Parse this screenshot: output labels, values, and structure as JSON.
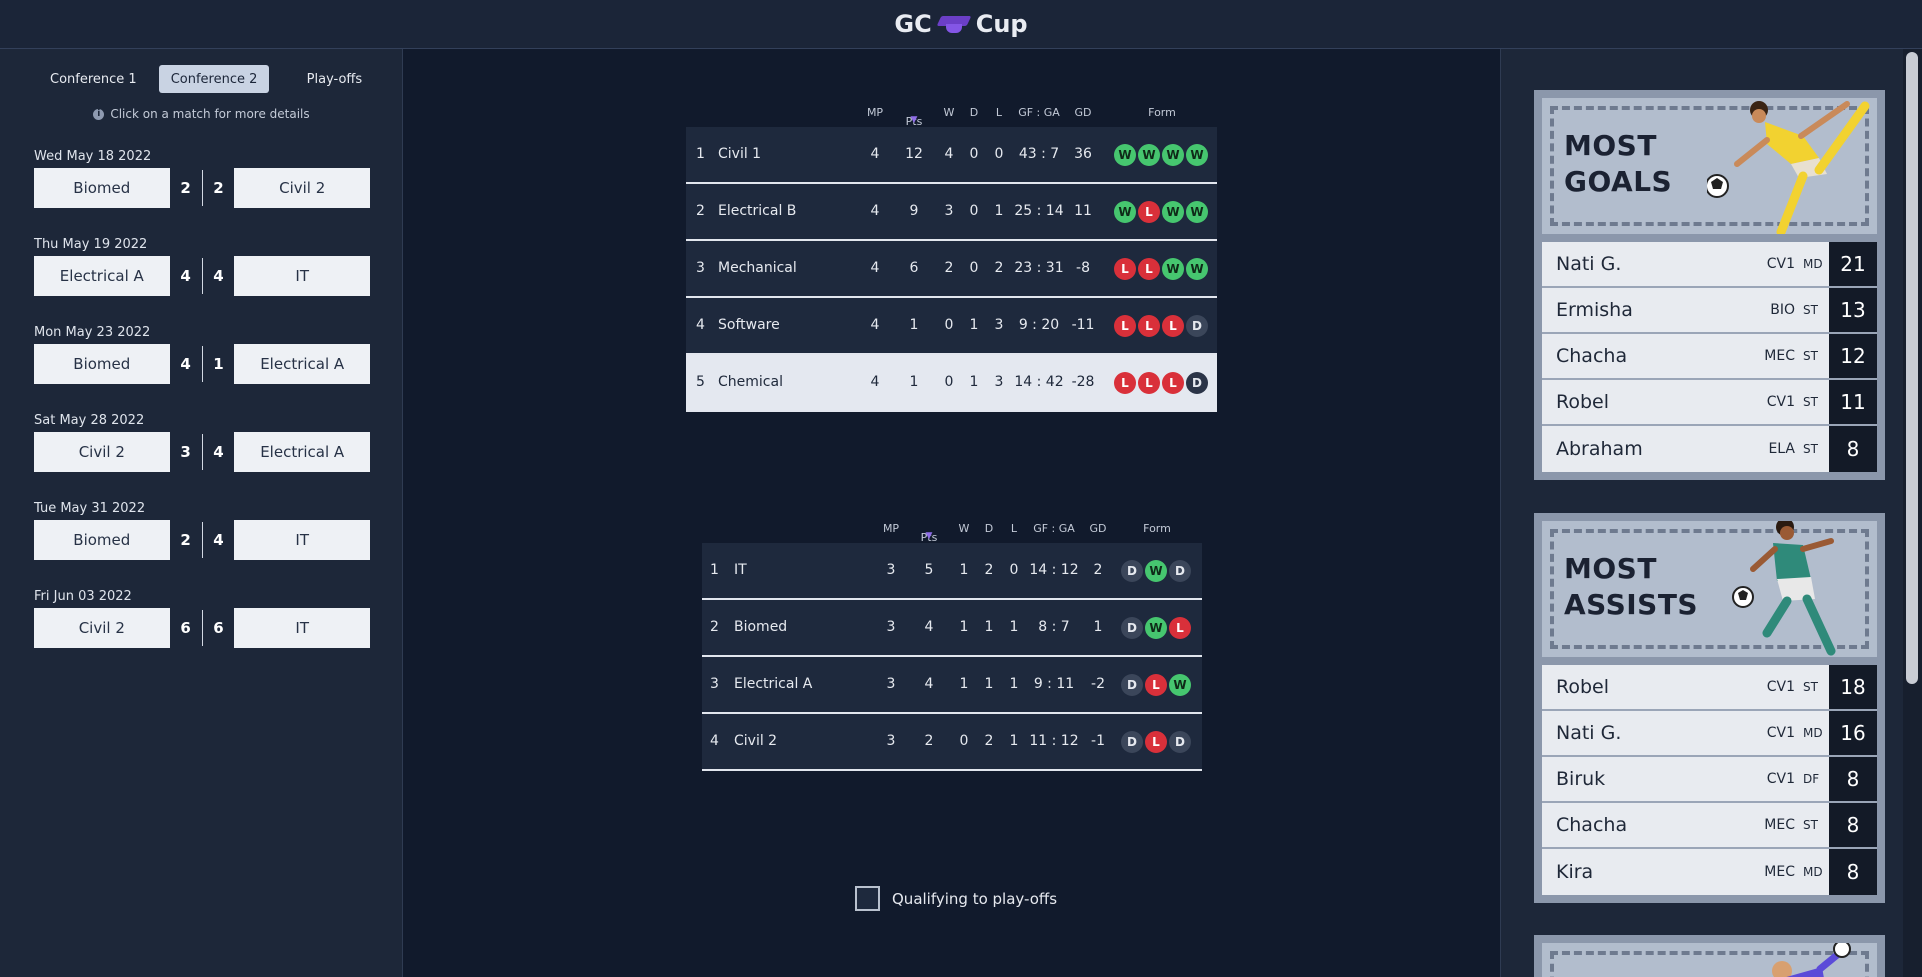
{
  "header": {
    "title_left": "GC",
    "title_right": "Cup"
  },
  "sidebar": {
    "tabs": [
      "Conference 1",
      "Conference 2",
      "Play-offs"
    ],
    "hint": "Click on a match for more details",
    "matches": [
      {
        "date": "Wed May 18 2022",
        "home": "Biomed",
        "home_score": "2",
        "away_score": "2",
        "away": "Civil 2"
      },
      {
        "date": "Thu May 19 2022",
        "home": "Electrical A",
        "home_score": "4",
        "away_score": "4",
        "away": "IT"
      },
      {
        "date": "Mon May 23 2022",
        "home": "Biomed",
        "home_score": "4",
        "away_score": "1",
        "away": "Electrical A"
      },
      {
        "date": "Sat May 28 2022",
        "home": "Civil 2",
        "home_score": "3",
        "away_score": "4",
        "away": "Electrical A"
      },
      {
        "date": "Tue May 31 2022",
        "home": "Biomed",
        "home_score": "2",
        "away_score": "4",
        "away": "IT"
      },
      {
        "date": "Fri Jun 03 2022",
        "home": "Civil 2",
        "home_score": "6",
        "away_score": "6",
        "away": "IT"
      }
    ]
  },
  "standings": {
    "columns": {
      "mp": "MP",
      "pts": "Pts",
      "w": "W",
      "d": "D",
      "l": "L",
      "gfga": "GF : GA",
      "gd": "GD",
      "form": "Form"
    },
    "tables": [
      {
        "rows": [
          {
            "rank": "1",
            "team": "Civil 1",
            "mp": "4",
            "pts": "12",
            "w": "4",
            "d": "0",
            "l": "0",
            "gfga": "43 : 7",
            "gd": "36",
            "form": [
              "W",
              "W",
              "W",
              "W"
            ]
          },
          {
            "rank": "2",
            "team": "Electrical B",
            "mp": "4",
            "pts": "9",
            "w": "3",
            "d": "0",
            "l": "1",
            "gfga": "25 : 14",
            "gd": "11",
            "form": [
              "W",
              "L",
              "W",
              "W"
            ]
          },
          {
            "rank": "3",
            "team": "Mechanical",
            "mp": "4",
            "pts": "6",
            "w": "2",
            "d": "0",
            "l": "2",
            "gfga": "23 : 31",
            "gd": "-8",
            "form": [
              "L",
              "L",
              "W",
              "W"
            ]
          },
          {
            "rank": "4",
            "team": "Software",
            "mp": "4",
            "pts": "1",
            "w": "0",
            "d": "1",
            "l": "3",
            "gfga": "9 : 20",
            "gd": "-11",
            "form": [
              "L",
              "L",
              "L",
              "D"
            ]
          },
          {
            "rank": "5",
            "team": "Chemical",
            "mp": "4",
            "pts": "1",
            "w": "0",
            "d": "1",
            "l": "3",
            "gfga": "14 : 42",
            "gd": "-28",
            "form": [
              "L",
              "L",
              "L",
              "D"
            ]
          }
        ]
      },
      {
        "rows": [
          {
            "rank": "1",
            "team": "IT",
            "mp": "3",
            "pts": "5",
            "w": "1",
            "d": "2",
            "l": "0",
            "gfga": "14 : 12",
            "gd": "2",
            "form": [
              "D",
              "W",
              "D"
            ]
          },
          {
            "rank": "2",
            "team": "Biomed",
            "mp": "3",
            "pts": "4",
            "w": "1",
            "d": "1",
            "l": "1",
            "gfga": "8 : 7",
            "gd": "1",
            "form": [
              "D",
              "W",
              "L"
            ]
          },
          {
            "rank": "3",
            "team": "Electrical A",
            "mp": "3",
            "pts": "4",
            "w": "1",
            "d": "1",
            "l": "1",
            "gfga": "9 : 11",
            "gd": "-2",
            "form": [
              "D",
              "L",
              "W"
            ]
          },
          {
            "rank": "4",
            "team": "Civil 2",
            "mp": "3",
            "pts": "2",
            "w": "0",
            "d": "2",
            "l": "1",
            "gfga": "11 : 12",
            "gd": "-1",
            "form": [
              "D",
              "L",
              "D"
            ]
          }
        ]
      }
    ],
    "legend": "Qualifying to play-offs"
  },
  "stats": {
    "goals": {
      "title_line1": "MOST",
      "title_line2": "GOALS",
      "rows": [
        {
          "name": "Nati G.",
          "team": "CV1",
          "pos": "MD",
          "value": "21"
        },
        {
          "name": "Ermisha",
          "team": "BIO",
          "pos": "ST",
          "value": "13"
        },
        {
          "name": "Chacha",
          "team": "MEC",
          "pos": "ST",
          "value": "12"
        },
        {
          "name": "Robel",
          "team": "CV1",
          "pos": "ST",
          "value": "11"
        },
        {
          "name": "Abraham",
          "team": "ELA",
          "pos": "ST",
          "value": "8"
        }
      ]
    },
    "assists": {
      "title_line1": "MOST",
      "title_line2": "ASSISTS",
      "rows": [
        {
          "name": "Robel",
          "team": "CV1",
          "pos": "ST",
          "value": "18"
        },
        {
          "name": "Nati G.",
          "team": "CV1",
          "pos": "MD",
          "value": "16"
        },
        {
          "name": "Biruk",
          "team": "CV1",
          "pos": "DF",
          "value": "8"
        },
        {
          "name": "Chacha",
          "team": "MEC",
          "pos": "ST",
          "value": "8"
        },
        {
          "name": "Kira",
          "team": "MEC",
          "pos": "MD",
          "value": "8"
        }
      ]
    }
  },
  "colors": {
    "win": "#46c66f",
    "loss": "#d9303a",
    "draw": "#3b465a",
    "accent": "#8f6de8"
  }
}
